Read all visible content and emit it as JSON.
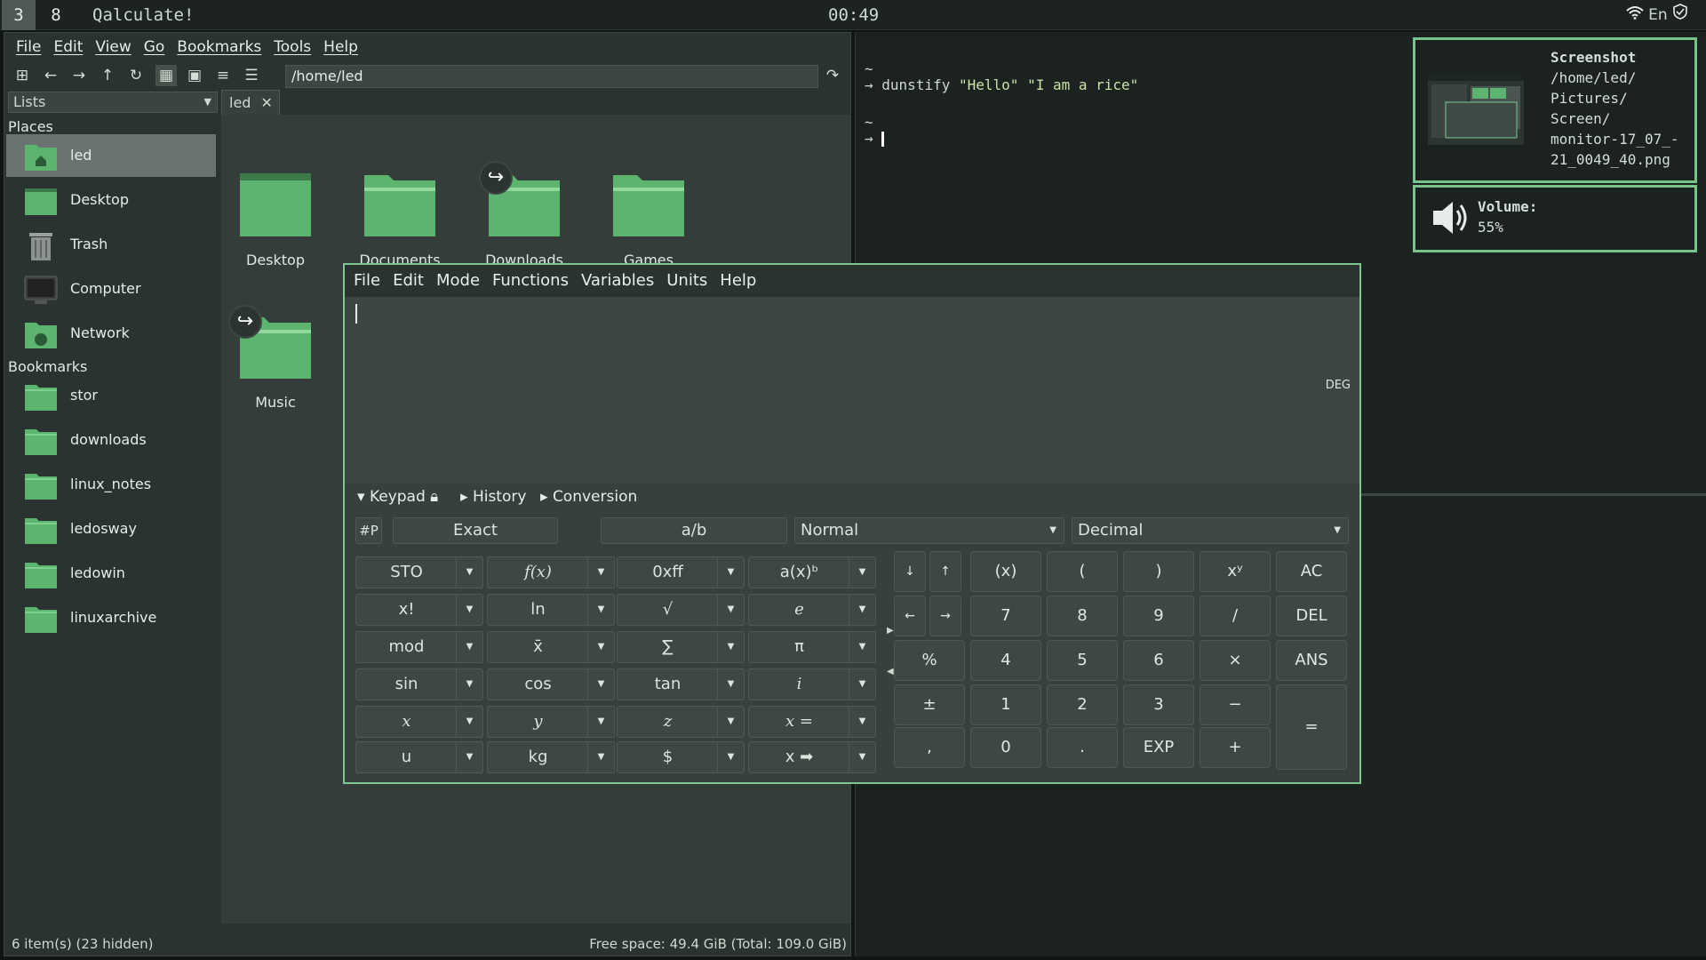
{
  "topbar": {
    "workspaces": [
      "3",
      "8"
    ],
    "window_title": "Qalculate!",
    "clock": "00:49",
    "keyboard_layout": "En"
  },
  "fm": {
    "menu": [
      "File",
      "Edit",
      "View",
      "Go",
      "Bookmarks",
      "Tools",
      "Help"
    ],
    "path": "/home/led",
    "side_combo": "Lists",
    "tab": "led",
    "places_header": "Places",
    "places": [
      "led",
      "Desktop",
      "Trash",
      "Computer",
      "Network"
    ],
    "bookmarks_header": "Bookmarks",
    "bookmarks": [
      "stor",
      "downloads",
      "linux_notes",
      "ledosway",
      "ledowin",
      "linuxarchive"
    ],
    "folders": [
      "Desktop",
      "Documents",
      "Downloads",
      "Games",
      "Music"
    ],
    "status_left": "6 item(s) (23 hidden)",
    "status_right": "Free space: 49.4 GiB (Total: 109.0 GiB)"
  },
  "terminal": {
    "tilde": "~",
    "cmd": "dunstify ",
    "arg1": "\"Hello\"",
    "arg2": "\"I am a rice\"",
    "prompt": "→",
    "prompt2": "→"
  },
  "notifications": {
    "n1_title": "Screenshot",
    "n1_lines": [
      "/home/led/",
      "Pictures/",
      "Screen/",
      "monitor-17_07_-",
      "21_0049_40.png"
    ],
    "n2_title": "Volume:",
    "n2_value": "55%"
  },
  "qalc": {
    "menu": [
      "File",
      "Edit",
      "Mode",
      "Functions",
      "Variables",
      "Units",
      "Help"
    ],
    "angle": "DEG",
    "tabs": {
      "keypad": "Keypad",
      "history": "History",
      "conversion": "Conversion"
    },
    "row1": {
      "hash": "#P",
      "exact": "Exact",
      "frac": "a/b",
      "mode": "Normal",
      "base": "Decimal"
    },
    "fkeys": [
      [
        "STO",
        "f(x)",
        "0xff",
        "a(x)ᵇ"
      ],
      [
        "x!",
        "ln",
        "√",
        "e"
      ],
      [
        "mod",
        "x̄",
        "∑",
        "π"
      ],
      [
        "sin",
        "cos",
        "tan",
        "i"
      ],
      [
        "x",
        "y",
        "z",
        "x ="
      ],
      [
        "u",
        "kg",
        "$",
        "x ➡"
      ]
    ],
    "keys": [
      [
        "↓",
        "↑",
        "(x)",
        "(",
        ")",
        "xʸ",
        "AC"
      ],
      [
        "←",
        "→",
        "7",
        "8",
        "9",
        "/",
        "DEL"
      ],
      [
        "%",
        "",
        "4",
        "5",
        "6",
        "×",
        "ANS"
      ],
      [
        "±",
        "",
        "1",
        "2",
        "3",
        "−",
        "="
      ],
      [
        ",",
        "",
        "0",
        ".",
        "EXP",
        "+",
        ""
      ]
    ]
  }
}
